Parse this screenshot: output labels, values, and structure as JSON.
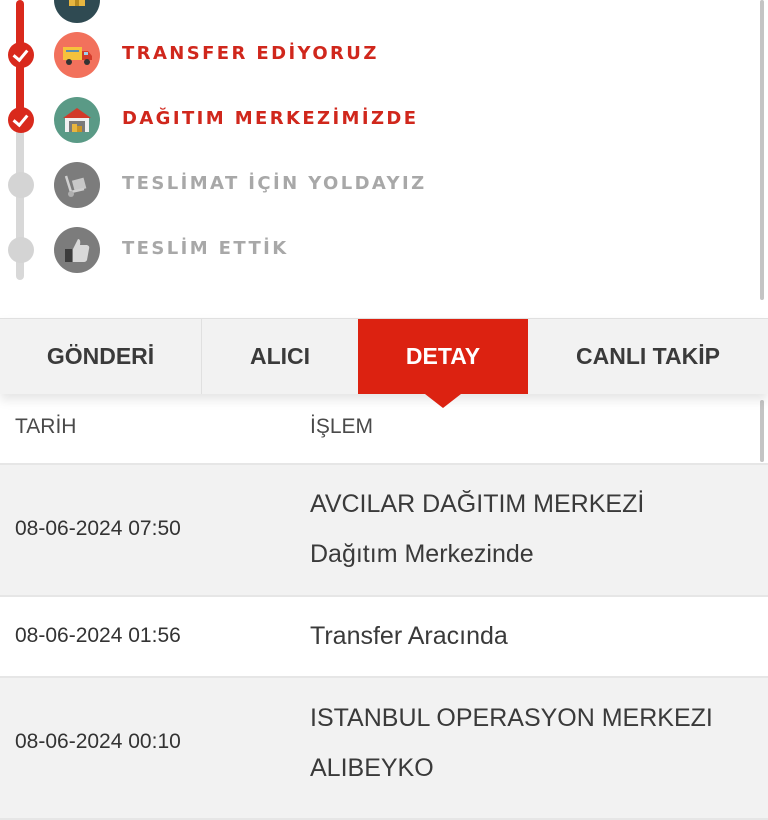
{
  "timeline": {
    "steps": [
      {
        "label": "",
        "state": "done",
        "icon": "box-icon"
      },
      {
        "label": "TRANSFER EDİYORUZ",
        "state": "done",
        "icon": "truck-icon"
      },
      {
        "label": "DAĞITIM MERKEZİMİZDE",
        "state": "done",
        "icon": "warehouse-icon"
      },
      {
        "label": "TESLİMAT İÇİN YOLDAYIZ",
        "state": "pending",
        "icon": "hand-cart-icon"
      },
      {
        "label": "TESLİM ETTİK",
        "state": "pending",
        "icon": "thumbs-up-icon"
      }
    ]
  },
  "tabs": [
    {
      "label": "GÖNDERİ"
    },
    {
      "label": "ALICI"
    },
    {
      "label": "DETAY",
      "active": true
    },
    {
      "label": "CANLI TAKİP"
    }
  ],
  "table": {
    "headers": {
      "date": "TARİH",
      "operation": "İŞLEM"
    },
    "rows": [
      {
        "date": "08-06-2024 07:50",
        "op_line1": "AVCILAR DAĞITIM MERKEZİ",
        "op_line2": "Dağıtım Merkezinde"
      },
      {
        "date": "08-06-2024 01:56",
        "op_line1": "Transfer Aracında",
        "op_line2": ""
      },
      {
        "date": "08-06-2024 00:10",
        "op_line1": "ISTANBUL OPERASYON MERKEZI",
        "op_line2": "ALIBEYKO"
      }
    ]
  },
  "colors": {
    "accent": "#d9291c",
    "pending": "#a8a8a8",
    "tab_background": "#f2f2f2",
    "row_alt": "#f2f2f2"
  }
}
